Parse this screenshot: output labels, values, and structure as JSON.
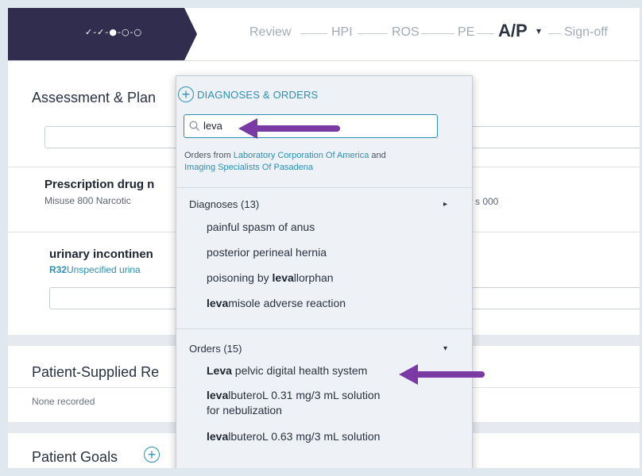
{
  "topbar": {
    "step_dots": "✓-✓-●-○-○",
    "steps": {
      "review": "Review",
      "hpi": "HPI",
      "ros": "ROS",
      "pe": "PE",
      "ap": "A/P",
      "signoff": "Sign-off"
    },
    "active_caret": "▾"
  },
  "assessment": {
    "title": "Assessment & Plan",
    "cards": [
      {
        "title": "Prescription drug n",
        "sub": "Misuse 800   Narcotic",
        "sub_tail": "s 000"
      },
      {
        "title": "urinary incontinen",
        "code": "R32",
        "code_label": " Unspecified urina"
      }
    ]
  },
  "patient_supplied": {
    "title": "Patient-Supplied Re",
    "empty": "None recorded"
  },
  "patient_goals": {
    "title": "Patient Goals"
  },
  "dropdown": {
    "header": "DIAGNOSES & ORDERS",
    "search_value": "leva",
    "orders_from_prefix": "Orders from ",
    "org1": "Laboratory Corporation Of America",
    "orders_from_and": " and",
    "org2": "Imaging Specialists Of Pasadena",
    "diagnoses": {
      "label": "Diagnoses (13)",
      "items": [
        {
          "pre": "",
          "bold": "",
          "post": "painful spasm of anus"
        },
        {
          "pre": "",
          "bold": "",
          "post": "posterior perineal hernia"
        },
        {
          "pre": "poisoning by ",
          "bold": "leva",
          "post": "llorphan"
        },
        {
          "pre": "",
          "bold": "leva",
          "post": "misole adverse reaction"
        }
      ]
    },
    "orders": {
      "label": "Orders (15)",
      "items": [
        {
          "bold": "Leva",
          "post": " pelvic digital health system",
          "line2": ""
        },
        {
          "bold": "leva",
          "post": "lbuteroL 0.31 mg/3 mL solution",
          "line2": "for nebulization"
        },
        {
          "bold": "leva",
          "post": "lbuteroL 0.63 mg/3 mL solution",
          "line2": ""
        }
      ]
    }
  },
  "colors": {
    "nav_dark": "#312d4f",
    "accent": "#2b8fb6",
    "annotation_arrow": "#7b3aa3"
  }
}
